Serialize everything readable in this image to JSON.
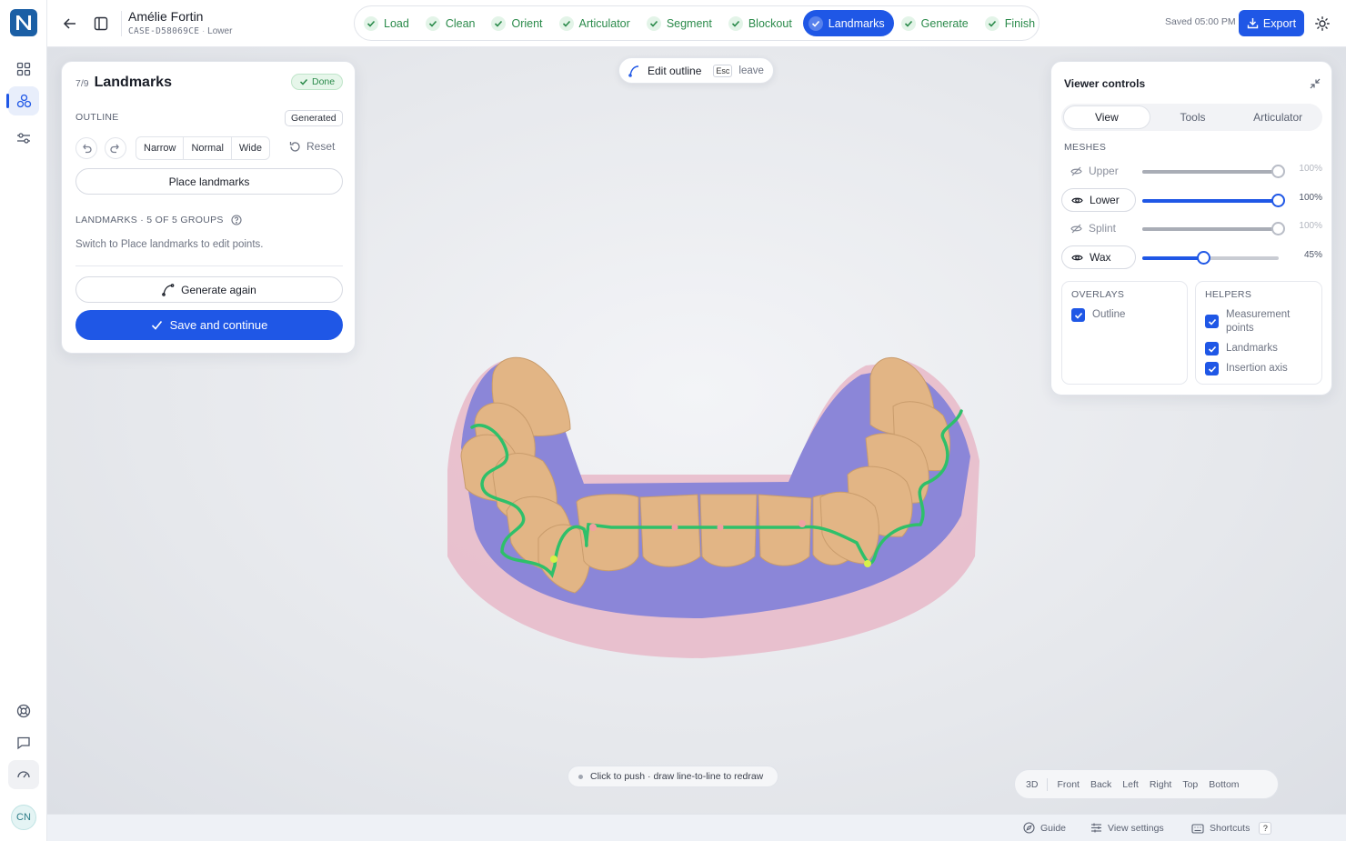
{
  "header": {
    "patient_name": "Amélie Fortin",
    "case_id": "CASE-D58069CE",
    "arch": "Lower",
    "saved": "Saved 05:00 PM",
    "export_label": "Export"
  },
  "steps": [
    {
      "label": "Load",
      "state": "done"
    },
    {
      "label": "Clean",
      "state": "done"
    },
    {
      "label": "Orient",
      "state": "done"
    },
    {
      "label": "Articulator",
      "state": "done"
    },
    {
      "label": "Segment",
      "state": "done"
    },
    {
      "label": "Blockout",
      "state": "done"
    },
    {
      "label": "Landmarks",
      "state": "active"
    },
    {
      "label": "Generate",
      "state": "done"
    },
    {
      "label": "Finish",
      "state": "done"
    }
  ],
  "left_panel": {
    "step_counter": "7/9",
    "title": "Landmarks",
    "status": "Done",
    "outline_label": "OUTLINE",
    "outline_status": "Generated",
    "widths": [
      "Narrow",
      "Normal",
      "Wide"
    ],
    "reset_label": "Reset",
    "place_label": "Place landmarks",
    "landmarks_label": "LANDMARKS · 5 OF 5 GROUPS",
    "hint": "Switch to Place landmarks to edit points.",
    "generate_again": "Generate again",
    "save_continue": "Save and continue"
  },
  "edit_pill": {
    "label": "Edit outline",
    "key": "Esc",
    "action": "leave"
  },
  "viewer_controls": {
    "title": "Viewer controls",
    "tabs": [
      {
        "label": "View",
        "active": true
      },
      {
        "label": "Tools",
        "active": false
      },
      {
        "label": "Articulator",
        "active": false
      }
    ],
    "meshes_label": "MESHES",
    "meshes": [
      {
        "label": "Upper",
        "visible": false,
        "opacity": 100,
        "pct": "100%"
      },
      {
        "label": "Lower",
        "visible": true,
        "opacity": 100,
        "pct": "100%"
      },
      {
        "label": "Splint",
        "visible": false,
        "opacity": 100,
        "pct": "100%"
      },
      {
        "label": "Wax",
        "visible": true,
        "opacity": 45,
        "pct": "45%"
      }
    ],
    "overlays_label": "OVERLAYS",
    "overlays": [
      {
        "label": "Outline",
        "checked": true
      }
    ],
    "helpers_label": "HELPERS",
    "helpers": [
      {
        "label": "Measurement points",
        "checked": true
      },
      {
        "label": "Landmarks",
        "checked": true
      },
      {
        "label": "Insertion axis",
        "checked": true
      }
    ]
  },
  "tip": "Click to push · draw line-to-line to redraw",
  "view_presets": [
    "3D",
    "Front",
    "Back",
    "Left",
    "Right",
    "Top",
    "Bottom"
  ],
  "bottom_bar": {
    "guide": "Guide",
    "view_settings": "View settings",
    "shortcuts": "Shortcuts",
    "shortcuts_key": "?"
  },
  "user_initials": "CN",
  "colors": {
    "accent": "#1f57e6",
    "success": "#2a8a4a",
    "tooth": "#e2b585",
    "gum": "#8b86d8",
    "base": "#e8b8c8",
    "outline": "#2ec06a"
  }
}
